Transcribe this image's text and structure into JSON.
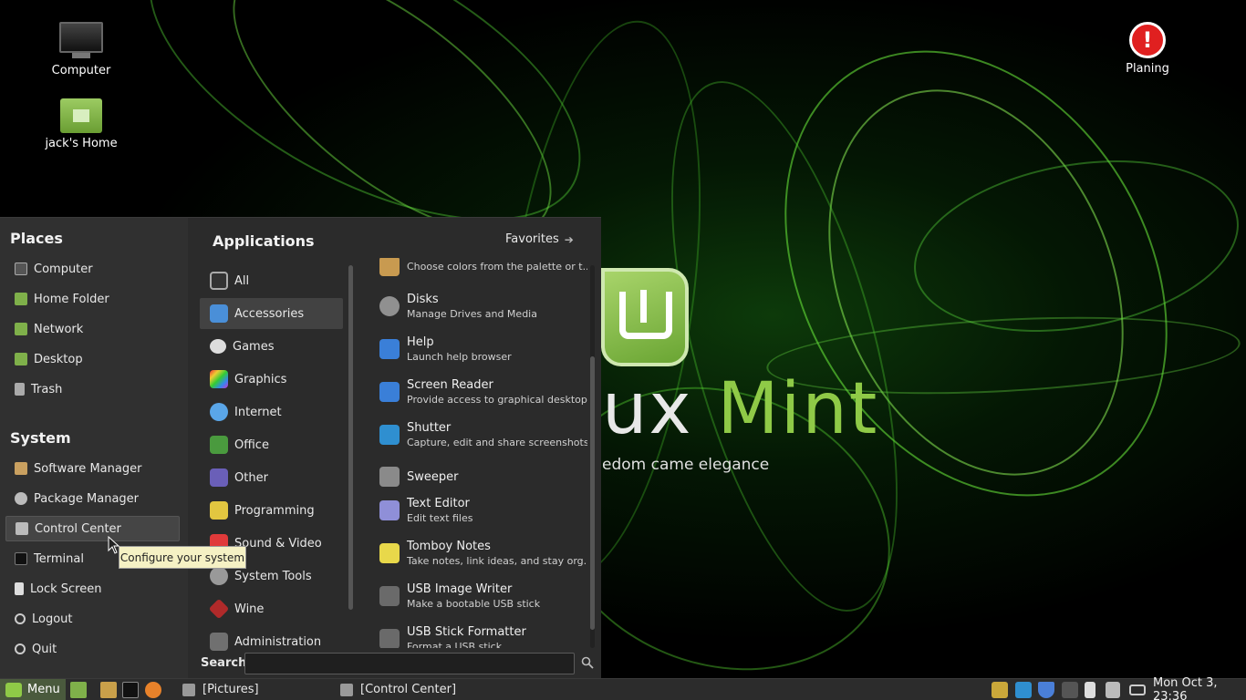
{
  "wallpaper": {
    "brand_word_main": "ux ",
    "brand_word_accent": "Mint",
    "tagline": "edom came elegance"
  },
  "desktop": {
    "icons": [
      {
        "label": "Computer"
      },
      {
        "label": "jack's Home"
      },
      {
        "label": "Planing"
      }
    ]
  },
  "menu": {
    "places_title": "Places",
    "places": [
      {
        "label": "Computer",
        "icon": "computer-icon"
      },
      {
        "label": "Home Folder",
        "icon": "home-folder-icon"
      },
      {
        "label": "Network",
        "icon": "network-icon"
      },
      {
        "label": "Desktop",
        "icon": "desktop-icon"
      },
      {
        "label": "Trash",
        "icon": "trash-icon"
      }
    ],
    "system_title": "System",
    "system": [
      {
        "label": "Software Manager",
        "icon": "software-manager-icon"
      },
      {
        "label": "Package Manager",
        "icon": "package-manager-icon"
      },
      {
        "label": "Control Center",
        "icon": "control-center-icon"
      },
      {
        "label": "Terminal",
        "icon": "terminal-icon"
      },
      {
        "label": "Lock Screen",
        "icon": "lock-icon"
      },
      {
        "label": "Logout",
        "icon": "logout-icon"
      },
      {
        "label": "Quit",
        "icon": "power-icon"
      }
    ],
    "applications_title": "Applications",
    "favorites_label": "Favorites",
    "categories": [
      {
        "label": "All",
        "color": "#3a3a3a"
      },
      {
        "label": "Accessories",
        "color": "#4a8fd8"
      },
      {
        "label": "Games",
        "color": "#3a3a3a"
      },
      {
        "label": "Graphics",
        "color": "#c84fb0"
      },
      {
        "label": "Internet",
        "color": "#5aa6e8"
      },
      {
        "label": "Office",
        "color": "#4a9a3e"
      },
      {
        "label": "Other",
        "color": "#6a5fb8"
      },
      {
        "label": "Programming",
        "color": "#e2c640"
      },
      {
        "label": "Sound & Video",
        "color": "#e03a3a"
      },
      {
        "label": "System Tools",
        "color": "#555555"
      },
      {
        "label": "Wine",
        "color": "#b02a2a"
      },
      {
        "label": "Administration",
        "color": "#707070"
      }
    ],
    "apps": [
      {
        "name": "",
        "desc": "Choose colors from the palette or t...",
        "color": "#c89a50"
      },
      {
        "name": "Disks",
        "desc": "Manage Drives and Media",
        "color": "#909090"
      },
      {
        "name": "Help",
        "desc": "Launch help browser",
        "color": "#3a7fd8"
      },
      {
        "name": "Screen Reader",
        "desc": "Provide access to graphical desktop...",
        "color": "#3a7fd8"
      },
      {
        "name": "Shutter",
        "desc": "Capture, edit and share screenshots",
        "color": "#2f8fd0"
      },
      {
        "name": "Sweeper",
        "desc": "",
        "color": "#8a8a8a"
      },
      {
        "name": "Text Editor",
        "desc": "Edit text files",
        "color": "#8f8fd8"
      },
      {
        "name": "Tomboy Notes",
        "desc": "Take notes, link ideas, and stay org...",
        "color": "#e8d84a"
      },
      {
        "name": "USB Image Writer",
        "desc": "Make a bootable USB stick",
        "color": "#6a6a6a"
      },
      {
        "name": "USB Stick Formatter",
        "desc": "Format a USB stick",
        "color": "#6a6a6a"
      }
    ],
    "search_label": "Search:",
    "search_value": "",
    "tooltip": "Configure your system"
  },
  "panel": {
    "menu_label": "Menu",
    "tasks": [
      {
        "label": "[Pictures]"
      },
      {
        "label": "[Control Center]"
      }
    ],
    "clock": "Mon Oct  3, 23:36"
  }
}
